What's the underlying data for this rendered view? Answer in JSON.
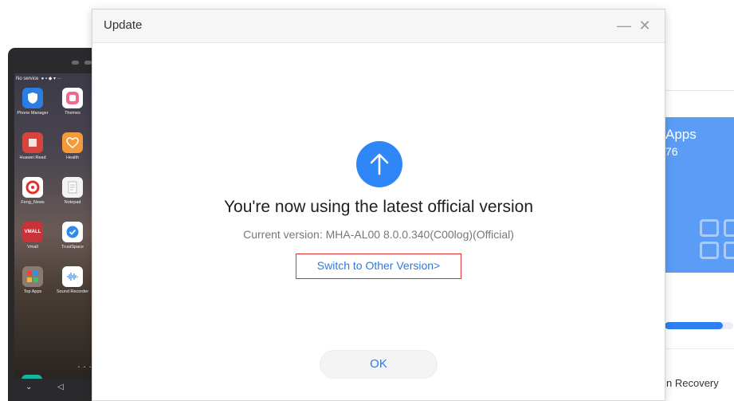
{
  "phone": {
    "status_text": "No service",
    "apps": [
      {
        "label": "Phone Manager",
        "color": "#2a7de1"
      },
      {
        "label": "Themes",
        "color": "#e85a8a"
      },
      {
        "label": "Huawei Read",
        "color": "#d6453d"
      },
      {
        "label": "Health",
        "color": "#f59a3a"
      },
      {
        "label": "Feng_News",
        "color": "#e0312f"
      },
      {
        "label": "Notepad",
        "color": "#f3f3f3"
      },
      {
        "label": "Vmall",
        "color": "#c8333a"
      },
      {
        "label": "TrustSpace",
        "color": "#2f8be8"
      },
      {
        "label": "Top Apps",
        "color": "#7a6a62"
      },
      {
        "label": "Sound Recorder",
        "color": "#ffffff"
      }
    ],
    "dock": [
      {
        "name": "phone",
        "color": "#15b59f"
      },
      {
        "name": "messages",
        "color": "#f39a2f"
      }
    ]
  },
  "background": {
    "apps_card_title": "Apps",
    "apps_card_count": "76",
    "progress_fraction": 0.85,
    "recovery_text": "n Recovery",
    "accent_color": "#5b9df6"
  },
  "dialog": {
    "title": "Update",
    "minimize_symbol": "—",
    "close_symbol": "✕",
    "headline": "You're now using the latest official version",
    "current_version": "Current version: MHA-AL00 8.0.0.340(C00log)(Official)",
    "switch_link": "Switch to Other Version>",
    "ok_label": "OK",
    "icon": "arrow-up-icon",
    "icon_color": "#2f86f6"
  }
}
